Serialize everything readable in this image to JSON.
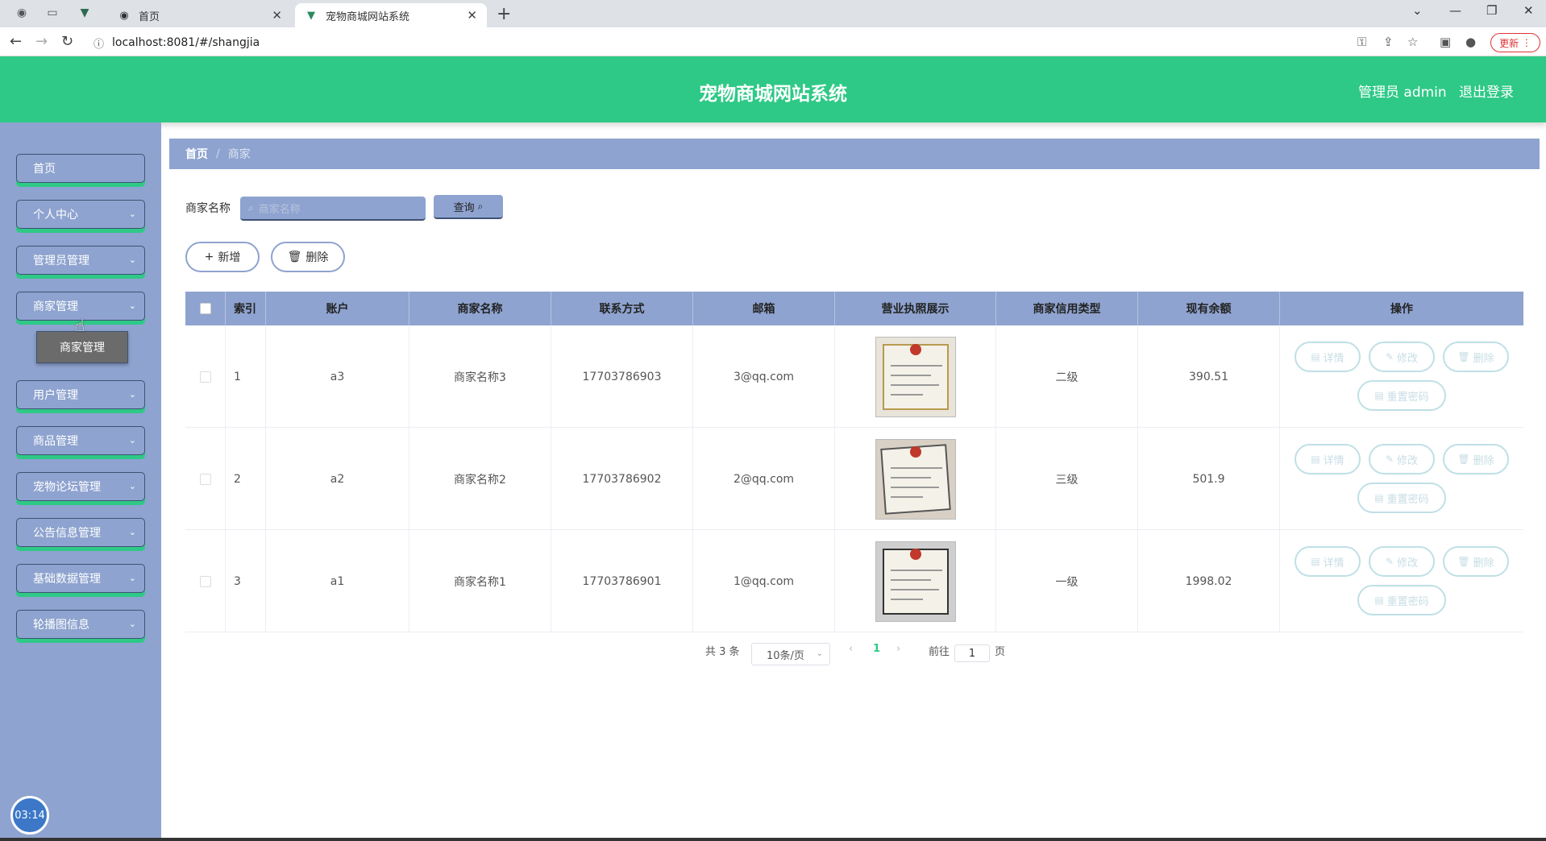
{
  "browser": {
    "tabs": [
      {
        "label": "首页",
        "active": false
      },
      {
        "label": "宠物商城网站系统",
        "active": true
      }
    ],
    "url": "localhost:8081/#/shangjia",
    "update_label": "更新"
  },
  "header": {
    "title": "宠物商城网站系统",
    "user_label": "管理员 admin",
    "logout_label": "退出登录"
  },
  "sidebar": {
    "items": [
      {
        "label": "首页",
        "has_arrow": false
      },
      {
        "label": "个人中心",
        "has_arrow": true
      },
      {
        "label": "管理员管理",
        "has_arrow": true
      },
      {
        "label": "商家管理",
        "has_arrow": true
      },
      {
        "label": "用户管理",
        "has_arrow": true
      },
      {
        "label": "商品管理",
        "has_arrow": true
      },
      {
        "label": "宠物论坛管理",
        "has_arrow": true
      },
      {
        "label": "公告信息管理",
        "has_arrow": true
      },
      {
        "label": "基础数据管理",
        "has_arrow": true
      },
      {
        "label": "轮播图信息",
        "has_arrow": true
      }
    ],
    "submenu_label": "商家管理",
    "timer": "03:14"
  },
  "breadcrumb": {
    "home": "首页",
    "separator": "/",
    "current": "商家"
  },
  "search": {
    "label": "商家名称",
    "placeholder": "商家名称",
    "query_label": "查询"
  },
  "actions": {
    "add_label": "新增",
    "delete_label": "删除"
  },
  "table": {
    "headers": [
      "索引",
      "账户",
      "商家名称",
      "联系方式",
      "邮箱",
      "营业执照展示",
      "商家信用类型",
      "现有余额",
      "操作"
    ],
    "rows": [
      {
        "index": "1",
        "account": "a3",
        "name": "商家名称3",
        "phone": "17703786903",
        "email": "3@qq.com",
        "credit": "二级",
        "balance": "390.51"
      },
      {
        "index": "2",
        "account": "a2",
        "name": "商家名称2",
        "phone": "17703786902",
        "email": "2@qq.com",
        "credit": "三级",
        "balance": "501.9"
      },
      {
        "index": "3",
        "account": "a1",
        "name": "商家名称1",
        "phone": "17703786901",
        "email": "1@qq.com",
        "credit": "一级",
        "balance": "1998.02"
      }
    ],
    "row_actions": {
      "detail": "详情",
      "edit": "修改",
      "delete": "删除",
      "reset": "重置密码"
    }
  },
  "pagination": {
    "total": "共 3 条",
    "page_size": "10条/页",
    "current_page": "1",
    "goto_label": "前往",
    "goto_value": "1",
    "page_suffix": "页"
  },
  "colors": {
    "header": "#2ec986",
    "sidebar": "#8ea3cf",
    "accent": "#2ec986"
  }
}
